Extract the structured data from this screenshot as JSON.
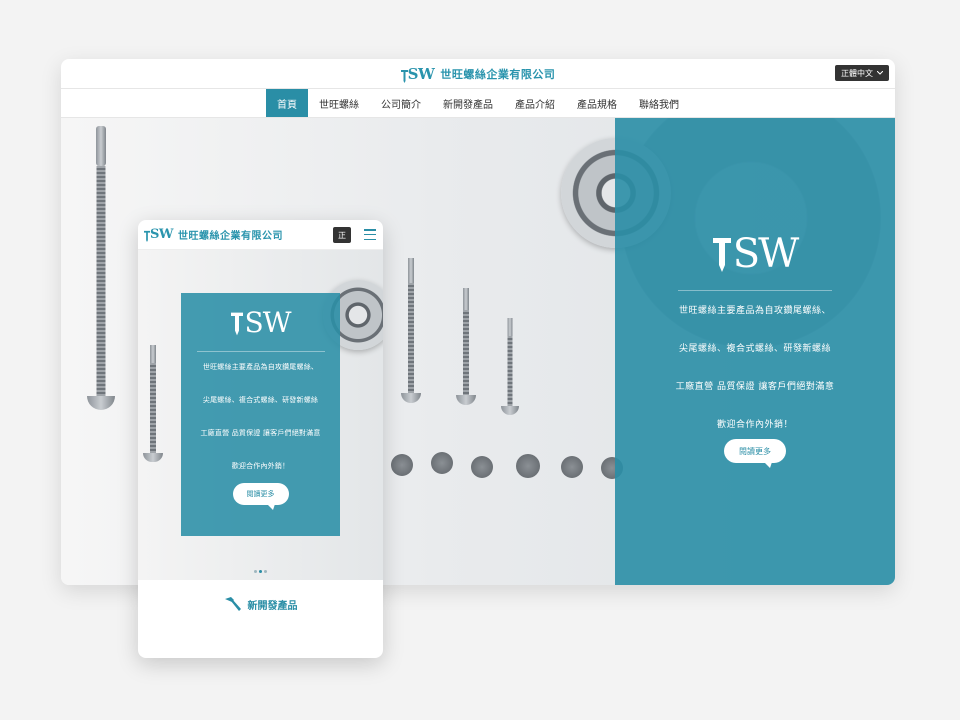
{
  "colors": {
    "brand": "#2a8ea6",
    "brand_text": "#2a94ad",
    "lang_bg": "#333333"
  },
  "desktop": {
    "header": {
      "logo_mark": "SW",
      "company_name": "世旺螺絲企業有限公司"
    },
    "language": {
      "selected": "正體中文"
    },
    "nav": [
      "首頁",
      "世旺螺絲",
      "公司簡介",
      "新開發產品",
      "產品介紹",
      "產品規格",
      "聯絡我們"
    ],
    "hero": {
      "logo_mark": "SW",
      "lines": [
        "世旺螺絲主要產品為自攻鑽尾螺絲、",
        "尖尾螺絲、複合式螺絲、研發新螺絲",
        "工廠直營 品質保證 讓客戶們絕對滿意",
        "歡迎合作內外銷！"
      ],
      "more_button": "閱讀更多"
    }
  },
  "mobile": {
    "header": {
      "logo_mark": "SW",
      "company_name": "世旺螺絲企業有限公司"
    },
    "language": {
      "selected": "正"
    },
    "hero": {
      "logo_mark": "SW",
      "lines": [
        "世旺螺絲主要產品為自攻鑽尾螺絲、",
        "尖尾螺絲、複合式螺絲、研發新螺絲",
        "工廠直營 品質保證 讓客戶們絕對滿意",
        "歡迎合作內外銷！"
      ],
      "more_button": "閱讀更多"
    },
    "section_title": "新開發產品",
    "section_icon": "hammer-icon"
  }
}
